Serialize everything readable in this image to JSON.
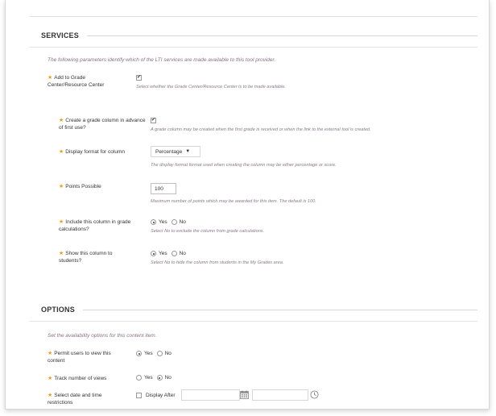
{
  "services": {
    "title": "SERVICES",
    "intro": "The following parameters identify which of the LTI services are made available to this tool provider.",
    "grade_center": {
      "label": "Add to Grade Center/Resource Center",
      "checked": true,
      "hint": "Select whether the Grade Center/Resource Center is to be made available."
    },
    "create_column": {
      "label": "Create a grade column in advance of first use?",
      "checked": true,
      "hint": "A grade column may be created when the first grade is received or when the link to the external tool is created."
    },
    "display_format": {
      "label": "Display format for column",
      "value": "Percentage",
      "hint": "The display format format used when creating the column may be either percentage or score."
    },
    "points_possible": {
      "label": "Points Possible",
      "value": "100",
      "hint": "Maximum number of points which may be awarded for this item. The default is 100."
    },
    "include_calc": {
      "label": "Include this column in grade calculations?",
      "yes": "Yes",
      "no": "No",
      "selected": "Yes",
      "hint": "Select No to exclude the column from grade calculations."
    },
    "show_students": {
      "label": "Show this column to students?",
      "yes": "Yes",
      "no": "No",
      "selected": "Yes",
      "hint": "Select No to hide the column from students in the My Grades area."
    }
  },
  "options": {
    "title": "OPTIONS",
    "intro": "Set the availability options for this content item.",
    "permit_view": {
      "label": "Permit users to view this content",
      "yes": "Yes",
      "no": "No",
      "selected": "Yes"
    },
    "track_views": {
      "label": "Track number of views",
      "yes": "Yes",
      "no": "No",
      "selected": "No"
    },
    "date_restrictions": {
      "label": "Select date and time restrictions",
      "display_after": "Display After"
    }
  },
  "colors": {
    "required_star": "#e8a317",
    "hint_text": "#8a7a8a",
    "intro_text": "#8a6f87"
  },
  "icons": [
    "required-star-icon",
    "calendar-icon",
    "clock-icon",
    "dropdown-caret-icon"
  ]
}
